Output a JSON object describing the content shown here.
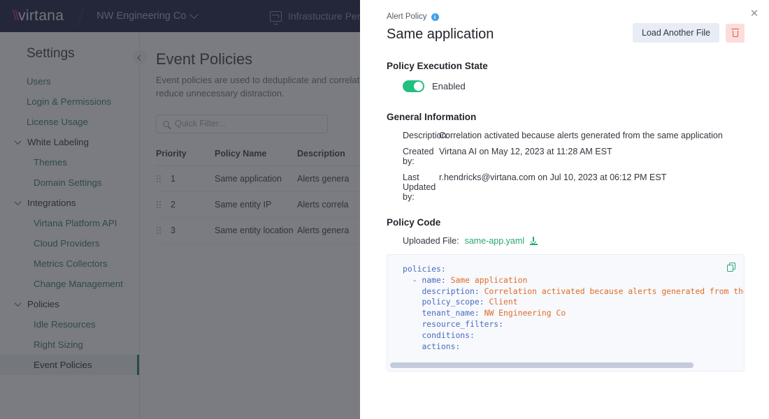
{
  "topbar": {
    "logo_text": "virtana",
    "tenant": "NW Engineering Co",
    "product": "Infrastucture Perform",
    "caret_icon": "chevron-down-icon",
    "monitor_icon": "monitor-icon"
  },
  "sidebar": {
    "title": "Settings",
    "collapse_icon": "chevron-left-icon",
    "items": [
      {
        "label": "Users",
        "level": "link",
        "active": false
      },
      {
        "label": "Login & Permissions",
        "level": "link",
        "active": false
      },
      {
        "label": "License Usage",
        "level": "link",
        "active": false
      },
      {
        "label": "White Labeling",
        "level": "group",
        "active": false
      },
      {
        "label": "Themes",
        "level": "sub",
        "active": false
      },
      {
        "label": "Domain Settings",
        "level": "sub",
        "active": false
      },
      {
        "label": "Integrations",
        "level": "group",
        "active": false
      },
      {
        "label": "Virtana Platform API",
        "level": "sub",
        "active": false
      },
      {
        "label": "Cloud Providers",
        "level": "sub",
        "active": false
      },
      {
        "label": "Metrics Collectors",
        "level": "sub",
        "active": false
      },
      {
        "label": "Change Management",
        "level": "sub",
        "active": false
      },
      {
        "label": "Policies",
        "level": "group",
        "active": false
      },
      {
        "label": "Idle Resources",
        "level": "sub",
        "active": false
      },
      {
        "label": "Right Sizing",
        "level": "sub",
        "active": false
      },
      {
        "label": "Event Policies",
        "level": "sub",
        "active": true
      }
    ]
  },
  "page": {
    "title": "Event Policies",
    "subtitle": "Event policies are used to deduplicate and correlate events to reduce unnecessary distraction.",
    "search": {
      "placeholder": "Quick Filter...",
      "value": "",
      "icon": "search-icon"
    },
    "table": {
      "columns": [
        "Priority",
        "Policy Name",
        "Description"
      ],
      "rows": [
        {
          "priority": "1",
          "name": "Same application",
          "description": "Alerts genera"
        },
        {
          "priority": "2",
          "name": "Same entity IP",
          "description": "Alerts correla"
        },
        {
          "priority": "3",
          "name": "Same entity location",
          "description": "Alerts genera"
        }
      ],
      "drag_icon": "drag-handle-icon"
    }
  },
  "panel": {
    "eyebrow": "Alert Policy",
    "info_icon": "info-icon",
    "info_glyph": "i",
    "title": "Same application",
    "close_icon": "close-icon",
    "close_glyph": "✕",
    "load_button": "Load Another File",
    "delete_icon": "trash-icon",
    "execution": {
      "heading": "Policy Execution State",
      "toggle_state": "on",
      "toggle_label": "Enabled"
    },
    "general": {
      "heading": "General Information",
      "rows": [
        {
          "key": "Description:",
          "value": "Correlation activated because alerts generated from the same application"
        },
        {
          "key": "Created by:",
          "value": "Virtana AI on May 12, 2023 at 11:28 AM EST"
        },
        {
          "key": "Last Updated by:",
          "value": "r.hendricks@virtana.com on Jul 10, 2023 at 06:12 PM EST"
        }
      ]
    },
    "code": {
      "heading": "Policy Code",
      "file_label": "Uploaded File:",
      "file_name": "same-app.yaml",
      "download_icon": "download-icon",
      "copy_icon": "copy-icon",
      "lines": [
        {
          "indent": 0,
          "key": "policies:",
          "value": ""
        },
        {
          "indent": 2,
          "key": "- name:",
          "value": "Same application"
        },
        {
          "indent": 4,
          "key": "description:",
          "value": "Correlation activated because alerts generated from the same app"
        },
        {
          "indent": 4,
          "key": "policy_scope:",
          "value": "Client"
        },
        {
          "indent": 4,
          "key": "tenant_name:",
          "value": "NW Engineering Co"
        },
        {
          "indent": 4,
          "key": "resource_filters:",
          "value": ""
        },
        {
          "indent": 4,
          "key": "conditions:",
          "value": ""
        },
        {
          "indent": 4,
          "key": "actions:",
          "value": ""
        }
      ],
      "scroll_thumb_percent": 85
    }
  },
  "colors": {
    "navbar": "#1e2044",
    "accent_green": "#2e7d64",
    "toggle_on": "#20c080",
    "delete_red": "#e2564a",
    "info_blue": "#3fa0e8",
    "code_key": "#4a6bc0",
    "code_value": "#e06c2a"
  }
}
